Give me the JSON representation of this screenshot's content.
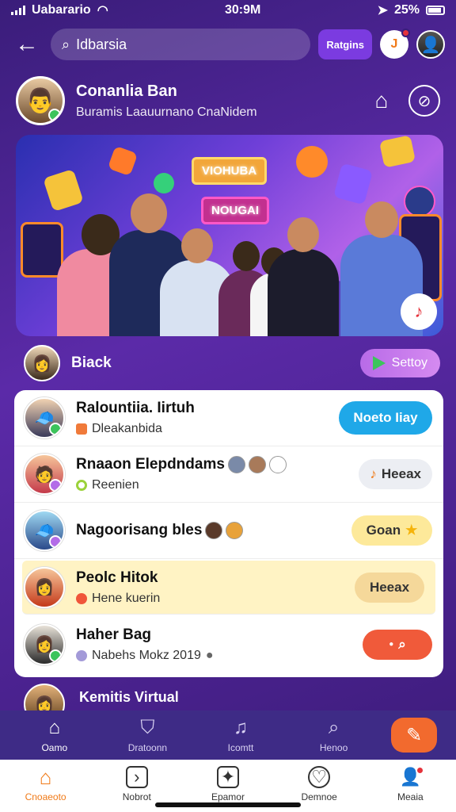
{
  "status_bar": {
    "carrier": "Uabarario",
    "time": "30:9M",
    "battery": "25%"
  },
  "topbar": {
    "search_value": "Idbarsia",
    "pill_label": "Ratgins",
    "round_btn_label": "J"
  },
  "profile": {
    "name": "Conanlia Ban",
    "subtitle": "Buramis Laauurnano CnaNidem"
  },
  "banner": {
    "sign_top": "VIOHUBA",
    "sign_mid": "NOUGAI"
  },
  "section": {
    "title": "Biack",
    "sort_label": "Settoy"
  },
  "list": [
    {
      "name": "Ralountiia. Iirtuh",
      "sub": "Dleakanbida",
      "action": "Noeto Iiay",
      "action_bg": "#1fa8e8",
      "action_color": "#ffffff",
      "sub_color": "#f07a3a"
    },
    {
      "name": "Rnaaon Elepdndams",
      "sub": "Reenien",
      "action": "Heeax",
      "action_bg": "#eceef3",
      "action_color": "#333333",
      "sub_color": "#9bd23a"
    },
    {
      "name": "Nagoorisang bles",
      "sub": "",
      "action": "Goan",
      "action_bg": "#fde99a",
      "action_color": "#333333",
      "sub_color": "#ffffff"
    },
    {
      "name": "Peolc Hitok",
      "sub": "Hene kuerin",
      "action": "Heeax",
      "action_bg": "#f5d89a",
      "action_color": "#333333",
      "sub_color": "#f0553a"
    },
    {
      "name": "Haher Bag",
      "sub": "Nabehs Mokz 2019",
      "action": "",
      "action_bg": "#f05a3a",
      "action_color": "#ffffff",
      "sub_color": "#a39ad8"
    }
  ],
  "peek": {
    "title": "Kemitis Virtual"
  },
  "tabbar_top": [
    {
      "label": "Oamo",
      "icon": "home-icon"
    },
    {
      "label": "Dratoonn",
      "icon": "shield-icon"
    },
    {
      "label": "Icomtt",
      "icon": "music-icon"
    },
    {
      "label": "Henoo",
      "icon": "search-icon"
    }
  ],
  "tabbar_bottom": [
    {
      "label": "Cnoaeoto",
      "icon": "home-icon"
    },
    {
      "label": "Nobrot",
      "icon": "play-icon"
    },
    {
      "label": "Epamor",
      "icon": "sparkle-icon"
    },
    {
      "label": "Demnoe",
      "icon": "heart-icon"
    },
    {
      "label": "Meaia",
      "icon": "profile-icon"
    }
  ],
  "colors": {
    "accent_orange": "#f07a18",
    "brand_purple": "#5b2aa8"
  }
}
